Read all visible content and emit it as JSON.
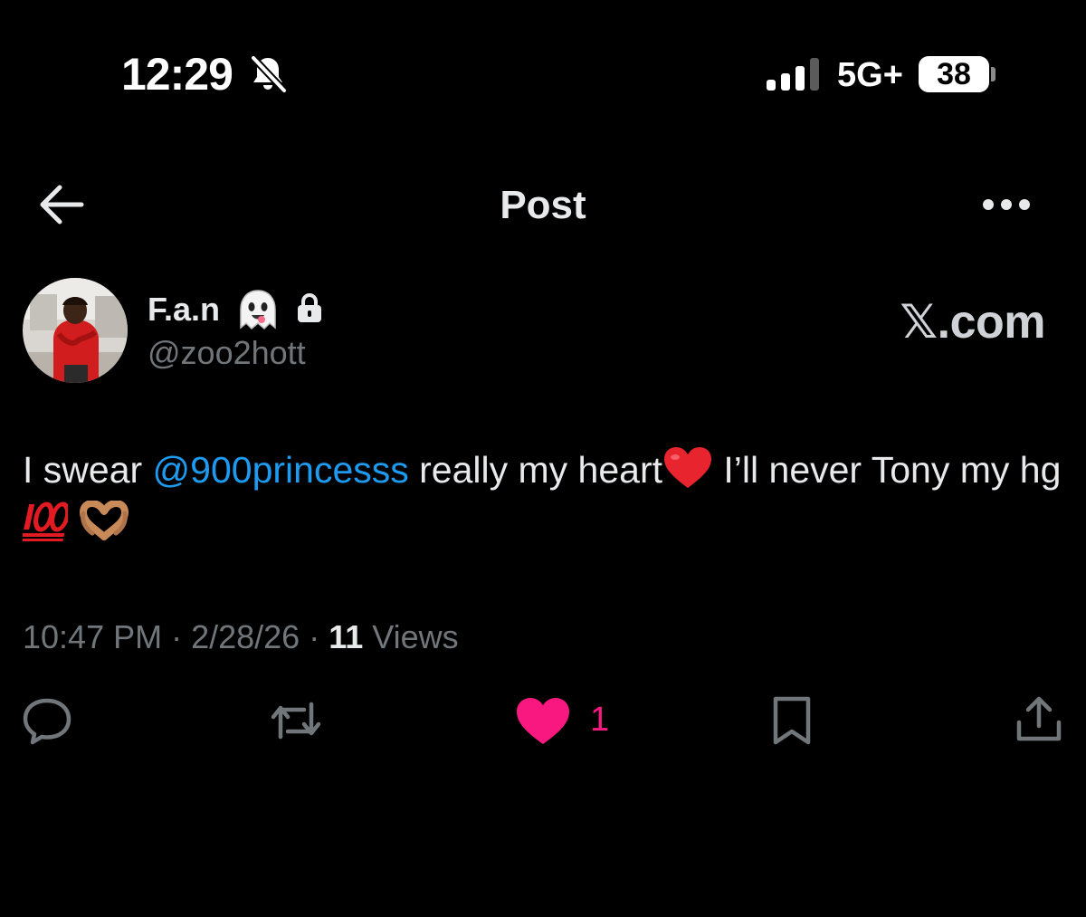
{
  "status_bar": {
    "time": "12:29",
    "network": "5G+",
    "battery": "38"
  },
  "header": {
    "title": "Post"
  },
  "author": {
    "display_name": "F.a.n",
    "handle": "@zoo2hott"
  },
  "brand": "𝕏.com",
  "post": {
    "text_before_mention": "I swear ",
    "mention": "@900princesss",
    "text_after_mention": " really my heart",
    "text_after_heart": " I’ll never Tony my hg"
  },
  "meta": {
    "time": "10:47 PM",
    "separator": " · ",
    "date": "2/28/26",
    "views_count": "11",
    "views_label": "Views"
  },
  "actions": {
    "like_count": "1"
  },
  "colors": {
    "background": "#000000",
    "text": "#e7e9ea",
    "muted": "#71767b",
    "link": "#1d9bf0",
    "like": "#f91880"
  },
  "icons": {
    "status": [
      "bell-slash-icon",
      "signal-icon",
      "battery-icon"
    ],
    "header": [
      "back-arrow-icon",
      "more-icon"
    ],
    "author": [
      "ghost-emoji-icon",
      "lock-icon"
    ],
    "post": [
      "red-heart-emoji-icon",
      "hundred-points-emoji-icon",
      "heart-hands-emoji-icon"
    ],
    "actions": [
      "reply-icon",
      "repost-icon",
      "like-icon",
      "bookmark-icon",
      "share-icon"
    ]
  }
}
